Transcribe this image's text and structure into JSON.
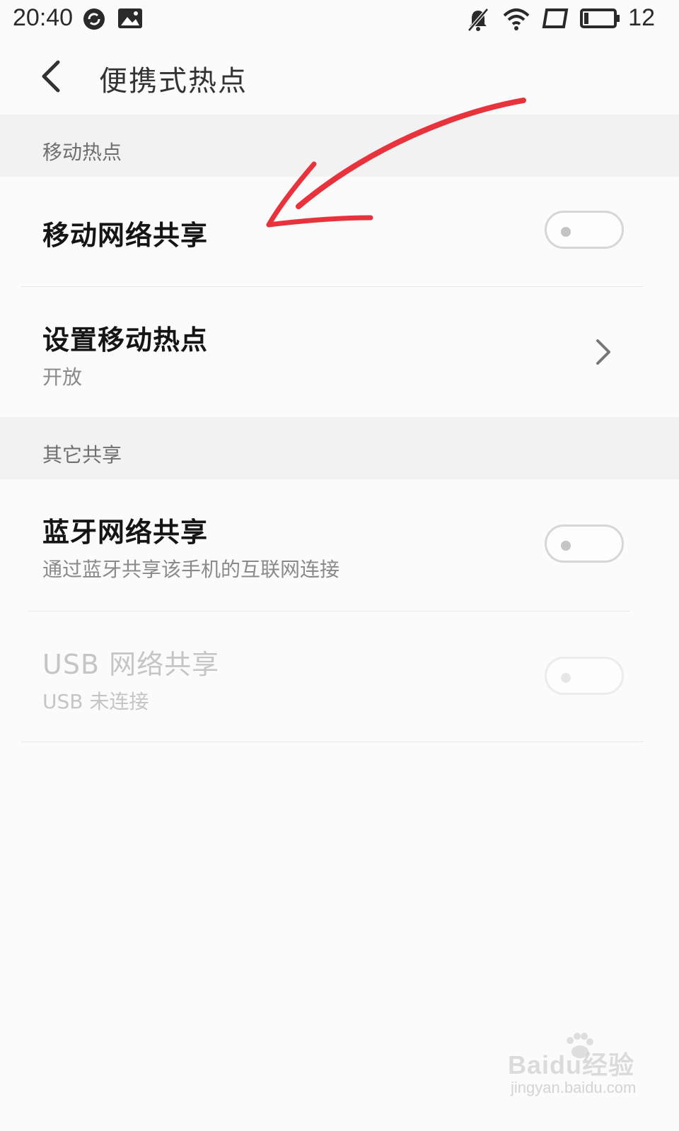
{
  "status_bar": {
    "time": "20:40",
    "battery_level": "12",
    "icons": [
      "sync-icon",
      "image-notification-icon",
      "silent-bell-icon",
      "wifi-icon",
      "screen-rotation-icon",
      "battery-icon"
    ]
  },
  "header": {
    "title": "便携式热点",
    "back_icon": "chevron-left-icon"
  },
  "sections": [
    {
      "header": "移动热点",
      "rows": [
        {
          "title": "移动网络共享",
          "type": "toggle",
          "state": "off"
        },
        {
          "title": "设置移动热点",
          "subtitle": "开放",
          "type": "navigation"
        }
      ]
    },
    {
      "header": "其它共享",
      "rows": [
        {
          "title": "蓝牙网络共享",
          "subtitle": "通过蓝牙共享该手机的互联网连接",
          "type": "toggle",
          "state": "off"
        },
        {
          "title": "USB 网络共享",
          "subtitle": "USB 未连接",
          "type": "toggle",
          "state": "off",
          "disabled": true
        }
      ]
    }
  ],
  "annotation": {
    "type": "arrow",
    "color": "#e8323c"
  },
  "watermark": {
    "logo": "Baidu经验",
    "url": "jingyan.baidu.com"
  }
}
